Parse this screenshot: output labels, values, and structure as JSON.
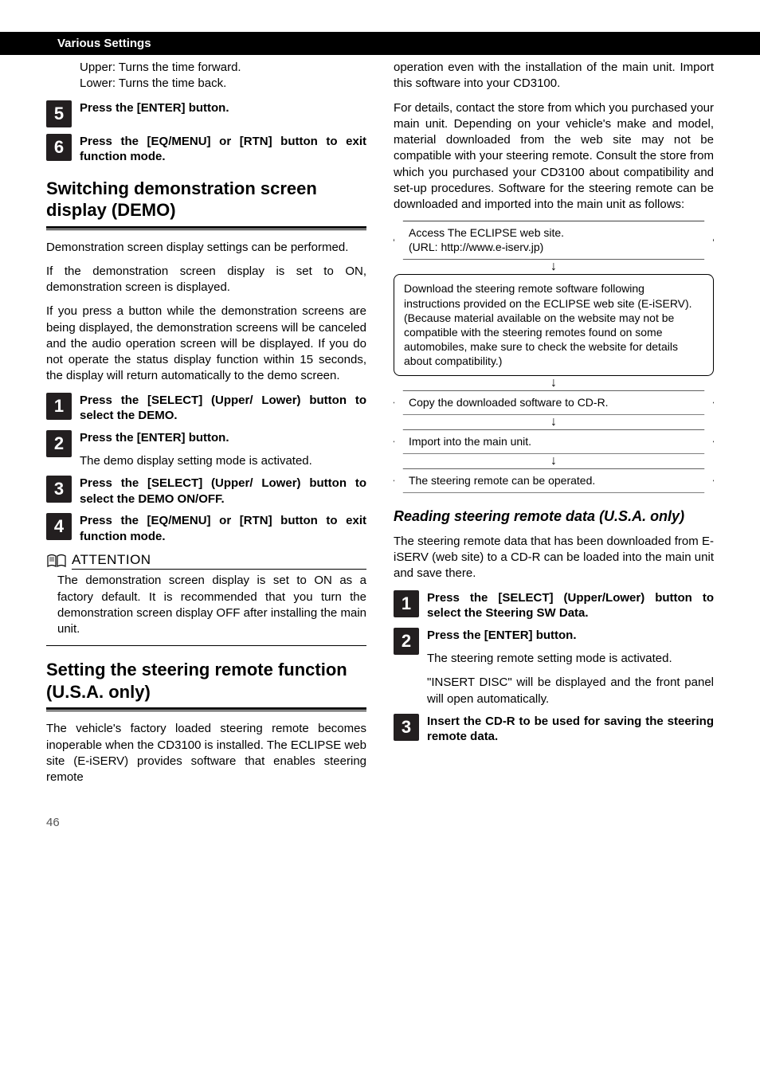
{
  "sectionBar": "Various Settings",
  "left": {
    "intro": {
      "line1": "Upper: Turns the time forward.",
      "line2": "Lower: Turns the time back."
    },
    "step5": "Press the [ENTER] button.",
    "step6": "Press the [EQ/MENU] or [RTN] button to exit function mode.",
    "heading1": "Switching demonstration screen display (DEMO)",
    "para1": "Demonstration screen display settings can be performed.",
    "para2": "If the demonstration screen display is set to ON, demonstration screen is displayed.",
    "para3": "If you press a button while the demonstration screens are being displayed, the demonstration screens will be canceled and the audio operation screen will be displayed. If you do not operate the status display function within 15 seconds, the display will return automatically to the demo screen.",
    "stepA1": "Press the [SELECT] (Upper/ Lower) button to select the DEMO.",
    "stepA2": "Press the [ENTER] button.",
    "stepA2sub": "The demo display setting mode is activated.",
    "stepA3": "Press the [SELECT] (Upper/ Lower) button to select the DEMO ON/OFF.",
    "stepA4": "Press the [EQ/MENU] or [RTN] button to exit function mode.",
    "attentionLabel": "ATTENTION",
    "attentionText": "The demonstration screen display is set to ON as a factory default. It is recommended that you turn the demonstration screen display OFF after installing the main unit.",
    "heading2": "Setting the steering remote function (U.S.A. only)",
    "para4": "The vehicle's factory loaded steering remote becomes inoperable when the CD3100 is installed. The ECLIPSE web site (E-iSERV) provides software that enables steering remote"
  },
  "right": {
    "paraTop1": "operation even with the installation of the main unit. Import this software into your CD3100.",
    "paraTop2": "For details, contact the store from which you purchased your main unit. Depending on your vehicle's make and model, material downloaded from the web site may not be compatible with your steering remote. Consult the store from which you purchased your CD3100 about compatibility and set-up procedures. Software for the steering remote can be downloaded and imported into the main unit as follows:",
    "flow": {
      "box1a": "Access The ECLIPSE web site.",
      "box1b": "(URL: http://www.e-iserv.jp)",
      "box2": "Download the steering remote software following instructions provided on the ECLIPSE web site (E-iSERV). (Because material available on the website may not be compatible with the steering remotes found on some automobiles, make sure to check the website for details about compatibility.)",
      "box3": "Copy the downloaded software to CD-R.",
      "box4": "Import into the main unit.",
      "box5": "The steering remote can be operated."
    },
    "subheading": "Reading steering remote data (U.S.A. only)",
    "para3": "The steering remote data that has been downloaded from E-iSERV (web site) to a CD-R can be loaded into the main unit and save there.",
    "stepB1": "Press the [SELECT] (Upper/Lower) button to select the Steering SW Data.",
    "stepB2": "Press the [ENTER] button.",
    "stepB2sub1": "The steering remote setting mode is activated.",
    "stepB2sub2": "\"INSERT DISC\" will be displayed and the front panel will open automatically.",
    "stepB3": "Insert the CD-R to be used for saving the steering remote data."
  },
  "pageNumber": "46"
}
